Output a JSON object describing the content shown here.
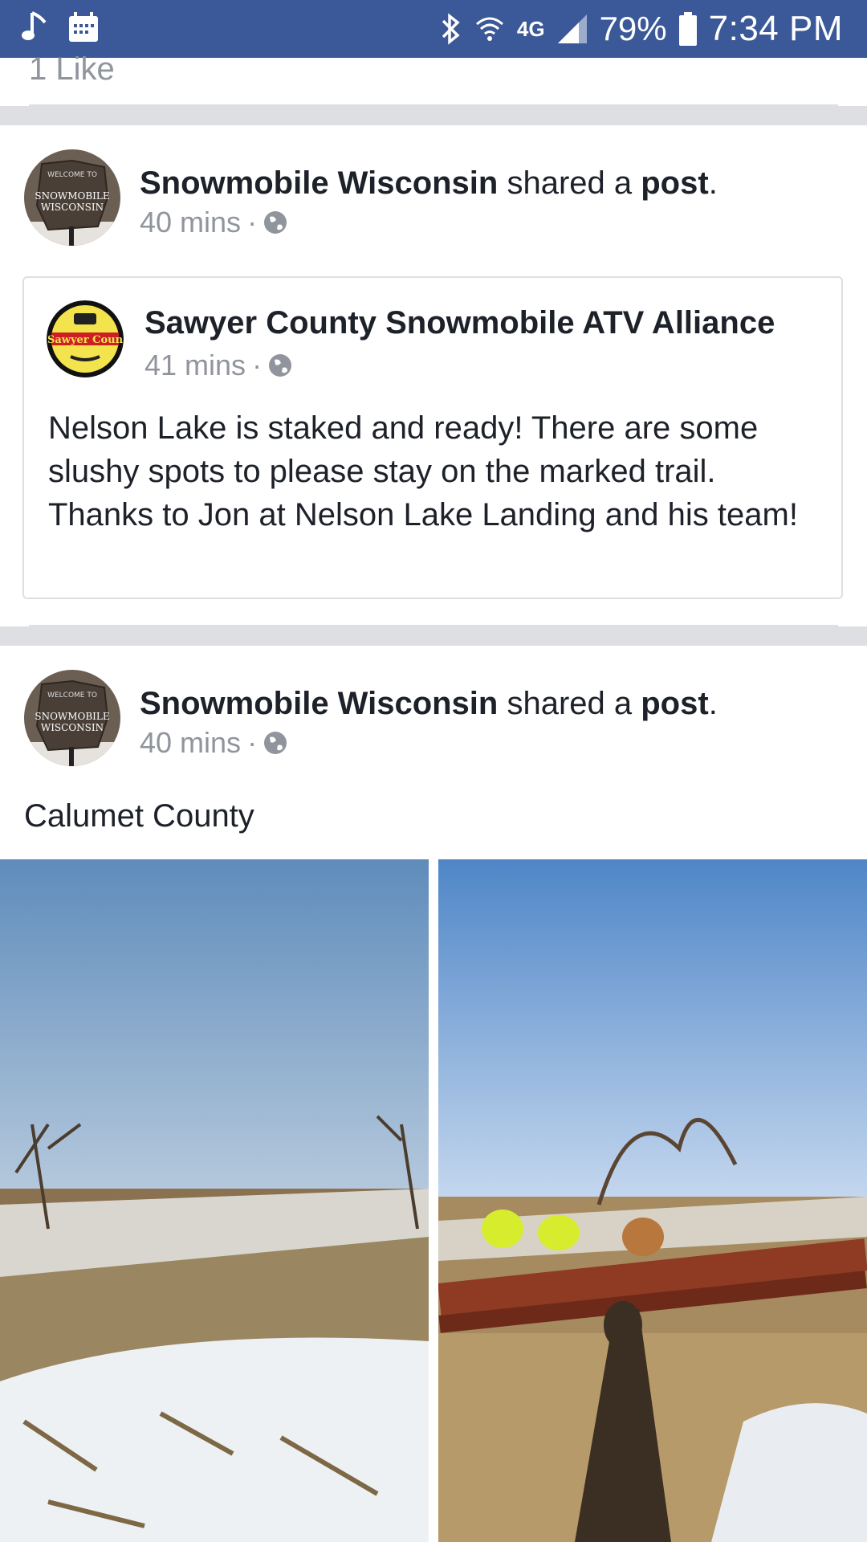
{
  "status_bar": {
    "battery": "79%",
    "time": "7:34 PM",
    "network": "4G"
  },
  "top_card": {
    "likes_text": "1 Like"
  },
  "post1": {
    "author": "Snowmobile Wisconsin",
    "action_mid": " shared a ",
    "action_obj": "post",
    "action_end": ".",
    "time": "40 mins",
    "dot": "·",
    "shared": {
      "page": "Sawyer County Snowmobile ATV Alliance",
      "time": "41 mins",
      "dot": "·",
      "text": "Nelson Lake is staked and ready! There are some slushy spots to please stay on the marked trail. Thanks to Jon at Nelson Lake Landing and his team!"
    }
  },
  "post2": {
    "author": "Snowmobile Wisconsin",
    "action_mid": " shared a ",
    "action_obj": "post",
    "action_end": ".",
    "time": "40 mins",
    "dot": "·",
    "caption": "Calumet County"
  },
  "avatar_sign": {
    "line1": "SNOWMOBILE",
    "line2": "WISCONSIN",
    "line3": "WELCOME TO"
  },
  "avatar_sawyer": {
    "text": "Sawyer County"
  },
  "colors": {
    "facebook_blue": "#3b5998",
    "text": "#1d2129",
    "meta": "#90949c",
    "divider": "#dddfe2"
  },
  "icons": [
    "music-note-icon",
    "calendar-icon",
    "bluetooth-icon",
    "wifi-icon",
    "signal-icon",
    "battery-icon",
    "globe-icon"
  ]
}
